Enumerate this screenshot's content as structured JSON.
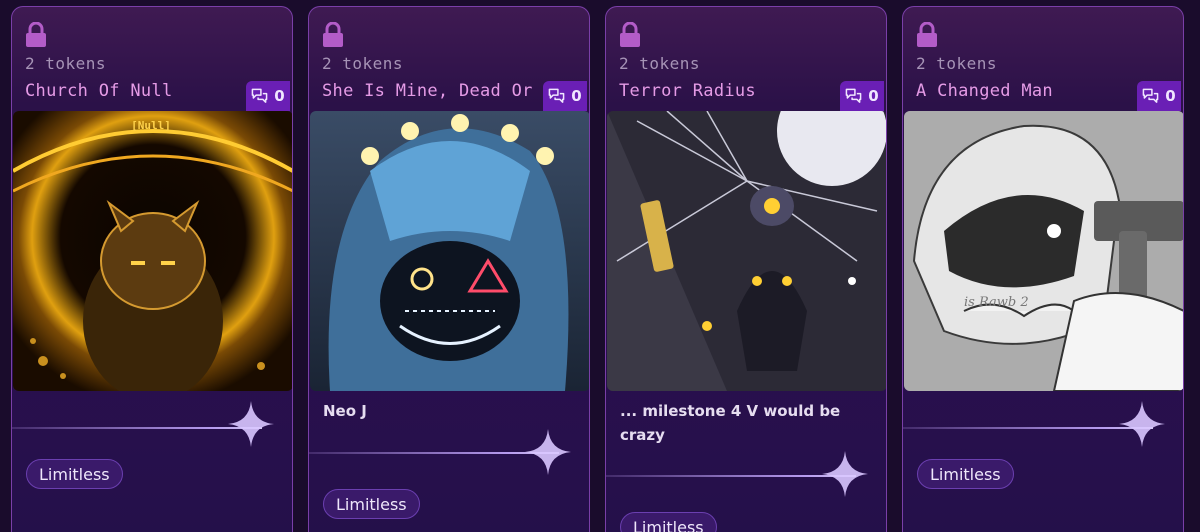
{
  "cards": [
    {
      "tokens": "2 tokens",
      "title": "Church Of Null",
      "chat_count": "0",
      "description": "",
      "tag": "Limitless",
      "art_label": "[Null]"
    },
    {
      "tokens": "2 tokens",
      "title": "She Is Mine, Dead Or Ali",
      "chat_count": "0",
      "description": "Neo J",
      "tag": "Limitless"
    },
    {
      "tokens": "2 tokens",
      "title": "Terror Radius",
      "chat_count": "0",
      "description": "... milestone 4 V would be crazy",
      "tag": "Limitless"
    },
    {
      "tokens": "2 tokens",
      "title": "A Changed Man",
      "chat_count": "0",
      "description": "",
      "tag": "Limitless",
      "art_label": "is Rawb 2"
    }
  ],
  "icons": {
    "lock": "lock-icon",
    "chat": "chat-bubbles-icon",
    "sparkle": "sparkle-icon"
  },
  "colors": {
    "title": "#e59be6",
    "badge": "#6a1fb5",
    "card_border": "#7a3fa8"
  }
}
